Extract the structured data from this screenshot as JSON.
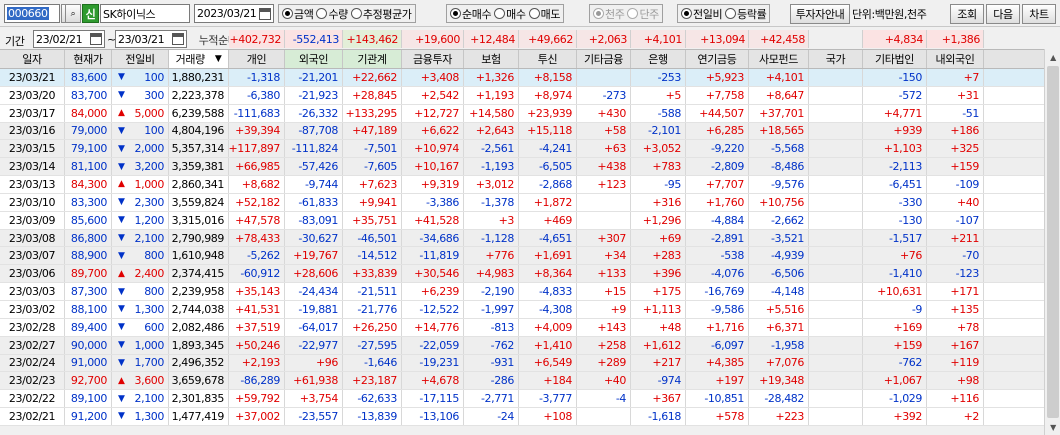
{
  "toolbar": {
    "code": "000660",
    "dropdown_glyph": "▾",
    "search_glyph": "⌕",
    "shin": "신",
    "name": "SK하이닉스",
    "date": "2023/03/21",
    "amount_radios": [
      {
        "label": "금액",
        "on": true
      },
      {
        "label": "수량",
        "on": false
      },
      {
        "label": "추정평균가",
        "on": false
      }
    ],
    "buy_radios": [
      {
        "label": "순매수",
        "on": true
      },
      {
        "label": "매수",
        "on": false
      },
      {
        "label": "매도",
        "on": false
      }
    ],
    "unit_radios": [
      {
        "label": "천주",
        "on": true
      },
      {
        "label": "단주",
        "on": false
      }
    ],
    "compare_radios": [
      {
        "label": "전일비",
        "on": true
      },
      {
        "label": "등락률",
        "on": false
      }
    ],
    "investor_button": "투자자안내",
    "unit_label": "단위:백만원,천주",
    "query_button": "조회",
    "next_button": "다음",
    "chart_button": "차트"
  },
  "period": {
    "label": "기간",
    "from": "23/02/21",
    "tilde": "~",
    "to": "23/03/21",
    "cum_label": "누적순매수",
    "values": [
      "+402,732",
      "-552,413",
      "+143,462",
      "+19,600",
      "+12,484",
      "+49,662",
      "+2,063",
      "+4,101",
      "+13,094",
      "+42,458",
      "",
      "+4,834",
      "+1,386"
    ]
  },
  "columns": [
    "일자",
    "현재가",
    "전일비",
    "거래량",
    "개인",
    "외국인",
    "기관계",
    "금융투자",
    "보험",
    "투신",
    "기타금융",
    "은행",
    "연기금등",
    "사모펀드",
    "국가",
    "기타법인",
    "내외국인"
  ],
  "sort_glyph": "▼",
  "rows": [
    {
      "date": "23/03/21",
      "price": "83,600",
      "dir": "dn",
      "chg": "100",
      "vol": "1,880,231",
      "v": [
        "-1,318",
        "-21,201",
        "+22,662",
        "+3,408",
        "+1,326",
        "+8,158",
        "",
        "-253",
        "+5,923",
        "+4,101",
        "",
        "-150",
        "+7"
      ]
    },
    {
      "date": "23/03/20",
      "price": "83,700",
      "dir": "dn",
      "chg": "300",
      "vol": "2,223,378",
      "v": [
        "-6,380",
        "-21,923",
        "+28,845",
        "+2,542",
        "+1,193",
        "+8,974",
        "-273",
        "+5",
        "+7,758",
        "+8,647",
        "",
        "-572",
        "+31"
      ]
    },
    {
      "date": "23/03/17",
      "price": "84,000",
      "dir": "up",
      "chg": "5,000",
      "vol": "6,239,588",
      "v": [
        "-111,683",
        "-26,332",
        "+133,295",
        "+12,727",
        "+14,580",
        "+23,939",
        "+430",
        "-588",
        "+44,507",
        "+37,701",
        "",
        "+4,771",
        "-51"
      ]
    },
    {
      "date": "23/03/16",
      "price": "79,000",
      "dir": "dn",
      "chg": "100",
      "vol": "4,804,196",
      "v": [
        "+39,394",
        "-87,708",
        "+47,189",
        "+6,622",
        "+2,643",
        "+15,118",
        "+58",
        "-2,101",
        "+6,285",
        "+18,565",
        "",
        "+939",
        "+186"
      ]
    },
    {
      "date": "23/03/15",
      "price": "79,100",
      "dir": "dn",
      "chg": "2,000",
      "vol": "5,357,314",
      "v": [
        "+117,897",
        "-111,824",
        "-7,501",
        "+10,974",
        "-2,561",
        "-4,241",
        "+63",
        "+3,052",
        "-9,220",
        "-5,568",
        "",
        "+1,103",
        "+325"
      ]
    },
    {
      "date": "23/03/14",
      "price": "81,100",
      "dir": "dn",
      "chg": "3,200",
      "vol": "3,359,381",
      "v": [
        "+66,985",
        "-57,426",
        "-7,605",
        "+10,167",
        "-1,193",
        "-6,505",
        "+438",
        "+783",
        "-2,809",
        "-8,486",
        "",
        "-2,113",
        "+159"
      ]
    },
    {
      "date": "23/03/13",
      "price": "84,300",
      "dir": "up",
      "chg": "1,000",
      "vol": "2,860,341",
      "v": [
        "+8,682",
        "-9,744",
        "+7,623",
        "+9,319",
        "+3,012",
        "-2,868",
        "+123",
        "-95",
        "+7,707",
        "-9,576",
        "",
        "-6,451",
        "-109"
      ]
    },
    {
      "date": "23/03/10",
      "price": "83,300",
      "dir": "dn",
      "chg": "2,300",
      "vol": "3,559,824",
      "v": [
        "+52,182",
        "-61,833",
        "+9,941",
        "-3,386",
        "-1,378",
        "+1,872",
        "",
        "+316",
        "+1,760",
        "+10,756",
        "",
        "-330",
        "+40"
      ]
    },
    {
      "date": "23/03/09",
      "price": "85,600",
      "dir": "dn",
      "chg": "1,200",
      "vol": "3,315,016",
      "v": [
        "+47,578",
        "-83,091",
        "+35,751",
        "+41,528",
        "+3",
        "+469",
        "",
        "+1,296",
        "-4,884",
        "-2,662",
        "",
        "-130",
        "-107"
      ]
    },
    {
      "date": "23/03/08",
      "price": "86,800",
      "dir": "dn",
      "chg": "2,100",
      "vol": "2,790,989",
      "v": [
        "+78,433",
        "-30,627",
        "-46,501",
        "-34,686",
        "-1,128",
        "-4,651",
        "+307",
        "+69",
        "-2,891",
        "-3,521",
        "",
        "-1,517",
        "+211"
      ]
    },
    {
      "date": "23/03/07",
      "price": "88,900",
      "dir": "dn",
      "chg": "800",
      "vol": "1,610,948",
      "v": [
        "-5,262",
        "+19,767",
        "-14,512",
        "-11,819",
        "+776",
        "+1,691",
        "+34",
        "+283",
        "-538",
        "-4,939",
        "",
        "+76",
        "-70"
      ]
    },
    {
      "date": "23/03/06",
      "price": "89,700",
      "dir": "up",
      "chg": "2,400",
      "vol": "2,374,415",
      "v": [
        "-60,912",
        "+28,606",
        "+33,839",
        "+30,546",
        "+4,983",
        "+8,364",
        "+133",
        "+396",
        "-4,076",
        "-6,506",
        "",
        "-1,410",
        "-123"
      ]
    },
    {
      "date": "23/03/03",
      "price": "87,300",
      "dir": "dn",
      "chg": "800",
      "vol": "2,239,958",
      "v": [
        "+35,143",
        "-24,434",
        "-21,511",
        "+6,239",
        "-2,190",
        "-4,833",
        "+15",
        "+175",
        "-16,769",
        "-4,148",
        "",
        "+10,631",
        "+171"
      ]
    },
    {
      "date": "23/03/02",
      "price": "88,100",
      "dir": "dn",
      "chg": "1,300",
      "vol": "2,744,038",
      "v": [
        "+41,531",
        "-19,881",
        "-21,776",
        "-12,522",
        "-1,997",
        "-4,308",
        "+9",
        "+1,113",
        "-9,586",
        "+5,516",
        "",
        "-9",
        "+135"
      ]
    },
    {
      "date": "23/02/28",
      "price": "89,400",
      "dir": "dn",
      "chg": "600",
      "vol": "2,082,486",
      "v": [
        "+37,519",
        "-64,017",
        "+26,250",
        "+14,776",
        "-813",
        "+4,009",
        "+143",
        "+48",
        "+1,716",
        "+6,371",
        "",
        "+169",
        "+78"
      ]
    },
    {
      "date": "23/02/27",
      "price": "90,000",
      "dir": "dn",
      "chg": "1,000",
      "vol": "1,893,345",
      "v": [
        "+50,246",
        "-22,977",
        "-27,595",
        "-22,059",
        "-762",
        "+1,410",
        "+258",
        "+1,612",
        "-6,097",
        "-1,958",
        "",
        "+159",
        "+167"
      ]
    },
    {
      "date": "23/02/24",
      "price": "91,000",
      "dir": "dn",
      "chg": "1,700",
      "vol": "2,496,352",
      "v": [
        "+2,193",
        "+96",
        "-1,646",
        "-19,231",
        "-931",
        "+6,549",
        "+289",
        "+217",
        "+4,385",
        "+7,076",
        "",
        "-762",
        "+119"
      ]
    },
    {
      "date": "23/02/23",
      "price": "92,700",
      "dir": "up",
      "chg": "3,600",
      "vol": "3,659,678",
      "v": [
        "-86,289",
        "+61,938",
        "+23,187",
        "+4,678",
        "-286",
        "+184",
        "+40",
        "-974",
        "+197",
        "+19,348",
        "",
        "+1,067",
        "+98"
      ]
    },
    {
      "date": "23/02/22",
      "price": "89,100",
      "dir": "dn",
      "chg": "2,100",
      "vol": "2,301,835",
      "v": [
        "+59,792",
        "+3,754",
        "-62,633",
        "-17,115",
        "-2,771",
        "-3,777",
        "-4",
        "+367",
        "-10,851",
        "-28,482",
        "",
        "-1,029",
        "+116"
      ]
    },
    {
      "date": "23/02/21",
      "price": "91,200",
      "dir": "dn",
      "chg": "1,300",
      "vol": "1,477,419",
      "v": [
        "+37,002",
        "-23,557",
        "-13,839",
        "-13,106",
        "-24",
        "+108",
        "",
        "-1,618",
        "+578",
        "+223",
        "",
        "+392",
        "+2"
      ]
    }
  ]
}
